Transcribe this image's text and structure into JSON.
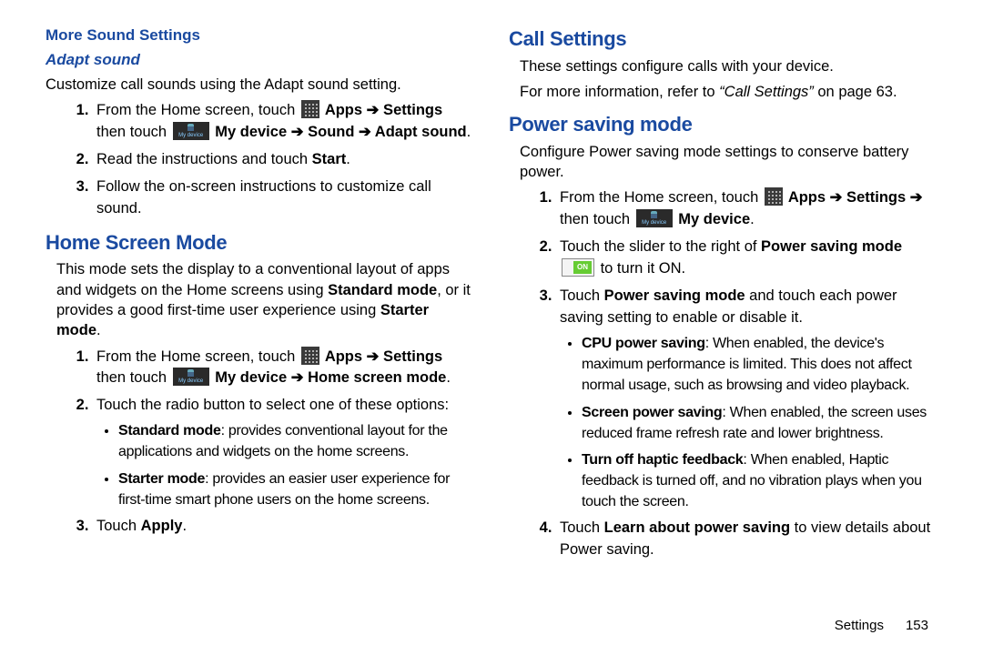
{
  "left": {
    "more_sound": "More Sound Settings",
    "adapt_sound": "Adapt sound",
    "adapt_intro": "Customize call sounds using the Adapt sound setting.",
    "adapt_steps": {
      "s1a": "From the Home screen, touch ",
      "s1b": " Apps ➔ Settings",
      "s1c": " then touch ",
      "s1d": " My device ➔ Sound  ➔ Adapt sound",
      "s1e": ".",
      "s2a": "Read the instructions and touch ",
      "s2b": "Start",
      "s2c": ".",
      "s3": "Follow the on-screen instructions to customize call sound."
    },
    "home_screen_mode": "Home Screen Mode",
    "hsm_p1a": "This mode sets the display to a conventional layout of apps and widgets on the Home screens using ",
    "hsm_p1b": "Standard mode",
    "hsm_p1c": ", or it provides a good first-time user experience using ",
    "hsm_p1d": "Starter mode",
    "hsm_p1e": ".",
    "hsm_steps": {
      "s1a": "From the Home screen, touch ",
      "s1b": " Apps ➔ Settings",
      "s1c": " then touch ",
      "s1d": " My device ➔ Home screen mode",
      "s1e": ".",
      "s2": "Touch the radio button to select one of these options:",
      "b1a": "Standard mode",
      "b1b": ": provides conventional layout for the applications and widgets on the home screens.",
      "b2a": "Starter mode",
      "b2b": ": provides an easier user experience for first-time smart phone users on the home screens.",
      "s3a": "Touch ",
      "s3b": "Apply",
      "s3c": "."
    }
  },
  "right": {
    "call_settings": "Call Settings",
    "cs_p1": "These settings configure calls with your device.",
    "cs_p2a": "For more information, refer to ",
    "cs_p2b": "“Call Settings”",
    "cs_p2c": "  on page 63.",
    "power_saving": "Power saving mode",
    "ps_intro": "Configure Power saving mode settings to conserve battery power.",
    "ps_steps": {
      "s1a": "From the Home screen, touch ",
      "s1b": " Apps ➔ Settings ➔",
      "s1c": " then touch ",
      "s1d": " My device",
      "s1e": ".",
      "s2a": "Touch the slider to the right of ",
      "s2b": "Power saving mode",
      "s2c": " to turn it ON.",
      "s3a": "Touch ",
      "s3b": "Power saving mode",
      "s3c": " and touch each power saving setting to enable or disable it.",
      "b1a": "CPU power saving",
      "b1b": ": When enabled, the device's maximum performance is limited. This does not affect normal usage, such as browsing and video playback.",
      "b2a": "Screen power saving",
      "b2b": ": When enabled, the screen uses reduced frame refresh rate and lower brightness.",
      "b3a": "Turn off haptic feedback",
      "b3b": ": When enabled, Haptic feedback is turned off, and no vibration plays when you touch the screen.",
      "s4a": "Touch ",
      "s4b": "Learn about power saving",
      "s4c": " to view details about Power saving."
    }
  },
  "footer": {
    "section": "Settings",
    "page": "153"
  }
}
